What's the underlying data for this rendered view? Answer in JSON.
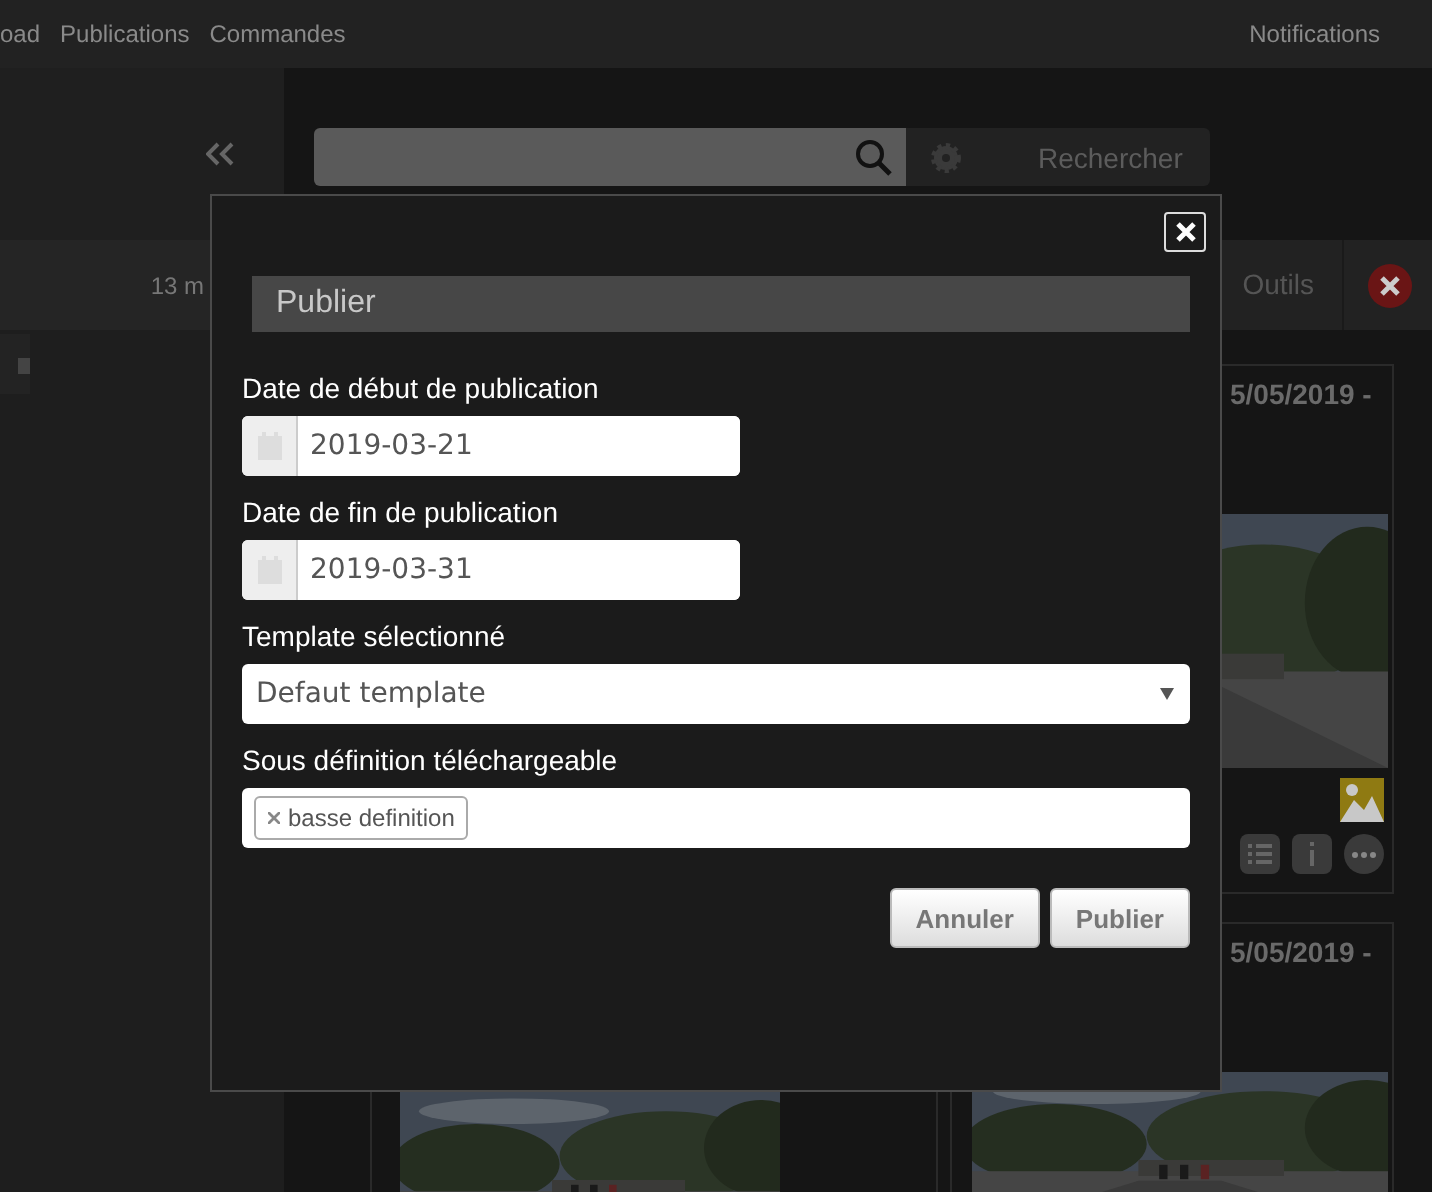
{
  "nav": {
    "items": [
      {
        "label": "oad"
      },
      {
        "label": "Publications"
      },
      {
        "label": "Commandes"
      }
    ],
    "notifications": "Notifications"
  },
  "sidebar": {
    "bar_text": "13 m"
  },
  "search": {
    "button": "Rechercher"
  },
  "toolbar": {
    "tools": "Outils"
  },
  "cards": [
    {
      "date": "5/05/2019 -"
    },
    {
      "date": "5/05/2019 -"
    }
  ],
  "dialog": {
    "title": "Publier",
    "fields": [
      {
        "kind": "date",
        "label": "Date de début de publication",
        "value": "2019-03-21"
      },
      {
        "kind": "date",
        "label": "Date de fin de publication",
        "value": "2019-03-31"
      },
      {
        "kind": "select",
        "label": "Template sélectionné",
        "value": "Defaut template"
      },
      {
        "kind": "tags",
        "label": "Sous définition téléchargeable",
        "tags": [
          "basse definition"
        ]
      }
    ],
    "buttons": [
      "Annuler",
      "Publier"
    ]
  }
}
